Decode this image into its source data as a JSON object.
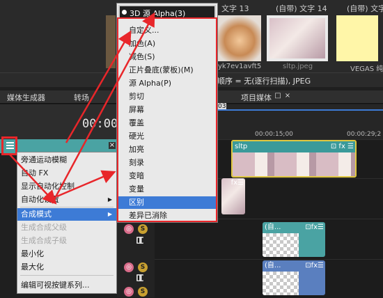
{
  "media": {
    "captions": [
      "文字 13",
      "(自带) 文字 14",
      "(自带) 文字"
    ],
    "labels": [
      "yk7ev1avft5",
      "sltp.jpeg",
      "VEGAS 纯"
    ],
    "partial_label": "5"
  },
  "info_bar": {
    "text": "顺序 = 无(逐行扫描), JPEG"
  },
  "tabs": {
    "media_generator": "媒体生成器",
    "transition": "转场",
    "project_media": "项目媒体"
  },
  "preview": {
    "time": "00:00"
  },
  "ruler": {
    "marker": "03",
    "t1": "00:00:15;00",
    "t2": "00:00:29;2"
  },
  "clips": {
    "main_title": "sltp",
    "auto1_title": "(自...",
    "auto2_title": "(自..."
  },
  "left_menu": {
    "items": [
      {
        "label": "旁通运动模糊",
        "state": "normal"
      },
      {
        "label": "自动 FX",
        "state": "normal"
      },
      {
        "label": "显示自动化控制",
        "state": "normal"
      },
      {
        "label": "自动化设置",
        "state": "submenu"
      },
      {
        "label": "合成模式",
        "state": "highlight"
      },
      {
        "label": "生成合成父级",
        "state": "disabled"
      },
      {
        "label": "生成合成子级",
        "state": "disabled"
      },
      {
        "label": "最小化",
        "state": "normal"
      },
      {
        "label": "最大化",
        "state": "normal"
      },
      {
        "label": "编辑可视按键系列...",
        "state": "normal"
      }
    ]
  },
  "composite_menu": {
    "top_item": "3D 源 Alpha(3)",
    "items": [
      {
        "label": "自定义..."
      },
      {
        "label": "加色(A)"
      },
      {
        "label": "减色(S)"
      },
      {
        "label": "正片叠底(蒙板)(M)"
      },
      {
        "label": "源 Alpha(P)"
      },
      {
        "label": "剪切"
      },
      {
        "label": "屏幕"
      },
      {
        "label": "覆盖"
      },
      {
        "label": "硬光"
      },
      {
        "label": "加亮"
      },
      {
        "label": "刻录"
      },
      {
        "label": "变暗"
      },
      {
        "label": "变量"
      },
      {
        "label": "区别",
        "highlight": true
      },
      {
        "label": "差异已消除"
      }
    ]
  },
  "colors": {
    "accent_blue": "#3d7bd6",
    "annotation_red": "#e8262a",
    "track_teal": "#4aa3a3"
  }
}
